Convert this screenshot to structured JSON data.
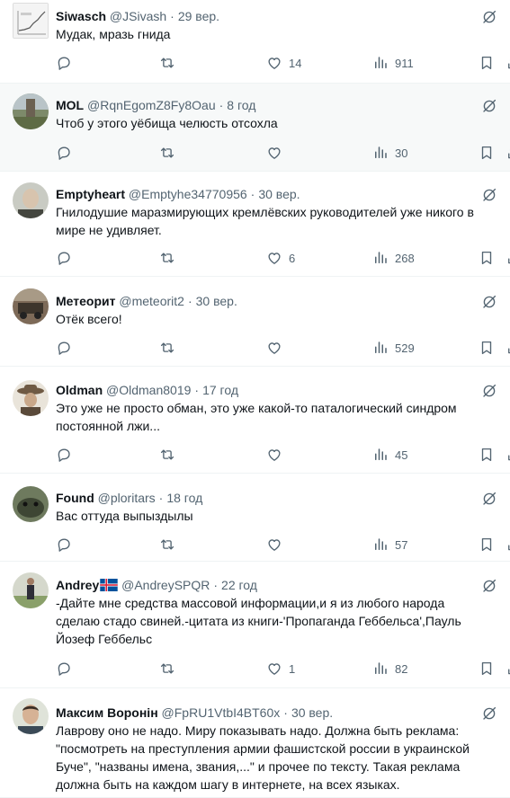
{
  "tweets": [
    {
      "name": "Siwasch",
      "handle": "@JSivash",
      "time": "29 вер.",
      "lines": [
        "Мудак, мразь гнида"
      ],
      "likes": "14",
      "views": "911",
      "avatar_icon": "chart-avatar-icon"
    },
    {
      "name": "MOL",
      "handle": "@RqnEgomZ8Fy8Oau",
      "time": "8 год",
      "lines": [
        "Чтоб у этого уёбища челюсть отсохла"
      ],
      "likes": "",
      "views": "30",
      "avatar_icon": "tower-photo-avatar"
    },
    {
      "name": "Emptyheart",
      "handle": "@Emptyhe34770956",
      "time": "30 вер.",
      "lines": [
        "Гнилодушие маразмирующих кремлёвских руководителей уже никого в",
        "мире не удивляет."
      ],
      "likes": "6",
      "views": "268",
      "avatar_icon": "portrait-avatar"
    },
    {
      "name": "Метеорит",
      "handle": "@meteorit2",
      "time": "30 вер.",
      "lines": [
        "Отёк всего!"
      ],
      "likes": "",
      "views": "529",
      "avatar_icon": "vehicle-avatar"
    },
    {
      "name": "Oldman",
      "handle": "@Oldman8019",
      "time": "17 год",
      "lines": [
        "Это уже не просто обман, это уже какой-то паталогический синдром",
        "постоянной лжи..."
      ],
      "likes": "",
      "views": "45",
      "avatar_icon": "cowboy-avatar"
    },
    {
      "name": "Found",
      "handle": "@ploritars",
      "time": "18 год",
      "lines": [
        "Вас оттуда выпыздылы"
      ],
      "likes": "",
      "views": "57",
      "avatar_icon": "animal-avatar"
    },
    {
      "name": "Andrey",
      "handle": "@AndreySPQR",
      "time": "22 год",
      "lines": [
        "-Дайте мне средства массовой информации,и я из любого народа",
        "сделаю стадо свиней.-цитата из книги-'Пропаганда Геббельса',Пауль",
        "Йозеф Геббельс"
      ],
      "likes": "1",
      "views": "82",
      "avatar_icon": "person-standing-avatar",
      "flag": "iceland-flag-icon"
    },
    {
      "name": "Максим Воронін",
      "handle": "@FpRU1VtbI4BT60x",
      "time": "30 вер.",
      "lines": [
        "Лаврову оно не надо. Миру показывать надо. Должна быть реклама:",
        "\"посмотреть на преступления армии фашистской россии в украинской",
        "Буче\", \"названы имена, звания,...\" и прочее по тексту. Такая реклама",
        "должна быть на каждом шагу в интернете, на всех языках."
      ],
      "likes": "",
      "views": "",
      "avatar_icon": "man-portrait-avatar"
    }
  ],
  "separator": "·",
  "colors": {
    "text": "#0f1419",
    "muted": "#536471",
    "border": "#eff3f4",
    "highlight": "#f7f9f9"
  }
}
